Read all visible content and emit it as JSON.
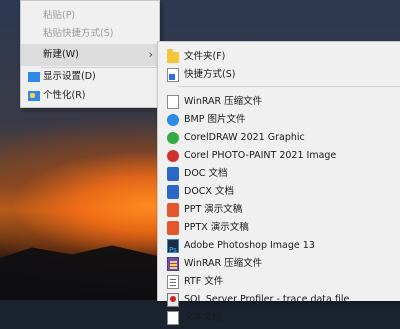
{
  "main_menu": {
    "items": [
      {
        "label": "粘贴(P)",
        "disabled": true
      },
      {
        "label": "粘贴快捷方式(S)",
        "disabled": true
      },
      {
        "label": "新建(W)",
        "has_submenu": true,
        "chevron": "›"
      },
      {
        "label": "显示设置(D)",
        "icon": "display-settings-icon"
      },
      {
        "label": "个性化(R)",
        "icon": "personalize-icon"
      }
    ]
  },
  "submenu": {
    "items": [
      {
        "label": "文件夹(F)",
        "icon": "folder-icon"
      },
      {
        "label": "快捷方式(S)",
        "icon": "shortcut-icon"
      },
      {
        "label": "WinRAR 压缩文件",
        "icon": "file-icon"
      },
      {
        "label": "BMP 图片文件",
        "icon": "bmp-icon"
      },
      {
        "label": "CorelDRAW 2021 Graphic",
        "icon": "coreldraw-icon"
      },
      {
        "label": "Corel PHOTO-PAINT 2021 Image",
        "icon": "photopaint-icon"
      },
      {
        "label": "DOC 文档",
        "icon": "doc-icon"
      },
      {
        "label": "DOCX 文档",
        "icon": "docx-icon"
      },
      {
        "label": "PPT 演示文稿",
        "icon": "ppt-icon"
      },
      {
        "label": "PPTX 演示文稿",
        "icon": "pptx-icon"
      },
      {
        "label": "Adobe Photoshop Image 13",
        "icon": "photoshop-icon"
      },
      {
        "label": "WinRAR 压缩文件",
        "icon": "winrar-icon"
      },
      {
        "label": "RTF 文件",
        "icon": "rtf-icon"
      },
      {
        "label": "SQL Server Profiler - trace data file",
        "icon": "sql-profiler-icon"
      },
      {
        "label": "文本文档",
        "icon": "text-document-icon"
      }
    ]
  }
}
